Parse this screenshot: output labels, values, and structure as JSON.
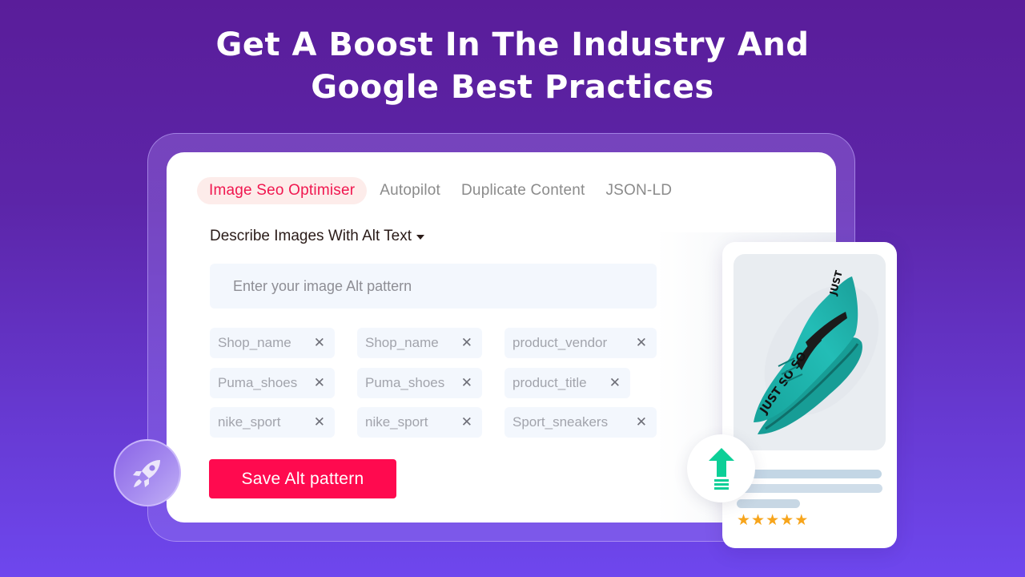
{
  "headline": {
    "line1": "Get A Boost In The Industry And",
    "line2": "Google Best Practices"
  },
  "tabs": [
    {
      "label": "Image Seo Optimiser",
      "active": true
    },
    {
      "label": "Autopilot",
      "active": false
    },
    {
      "label": "Duplicate Content",
      "active": false
    },
    {
      "label": "JSON-LD",
      "active": false
    }
  ],
  "section": {
    "title": "Describe Images With Alt Text",
    "caret_icon": "caret-down-icon"
  },
  "alt_input": {
    "value": "",
    "placeholder": "Enter your image Alt pattern"
  },
  "chips": [
    {
      "label": "Shop_name",
      "close": "✕"
    },
    {
      "label": "Shop_name",
      "close": "✕"
    },
    {
      "label": "product_vendor",
      "close": "✕"
    },
    {
      "label": "Puma_shoes",
      "close": "✕"
    },
    {
      "label": "Puma_shoes",
      "close": "✕"
    },
    {
      "label": "product_title",
      "close": "✕"
    },
    {
      "label": "nike_sport",
      "close": "✕"
    },
    {
      "label": "nike_sport",
      "close": "✕"
    },
    {
      "label": "Sport_sneakers",
      "close": "✕"
    }
  ],
  "save_button": {
    "label": "Save Alt pattern"
  },
  "product_card": {
    "image_icon": "sneaker-image",
    "shoe_text": "JUST SO SO",
    "rating": {
      "value": 5,
      "max": 5,
      "glyph": "★"
    }
  },
  "badges": {
    "rocket": "rocket-icon",
    "boost": "arrow-up-icon"
  },
  "colors": {
    "accent": "#ff0a4f",
    "active_tab_text": "#f0174f",
    "active_tab_bg": "#fdecea",
    "boost_green": "#0ccf97",
    "star": "#f7a51c",
    "shoe_teal": "#1fb3ad"
  }
}
